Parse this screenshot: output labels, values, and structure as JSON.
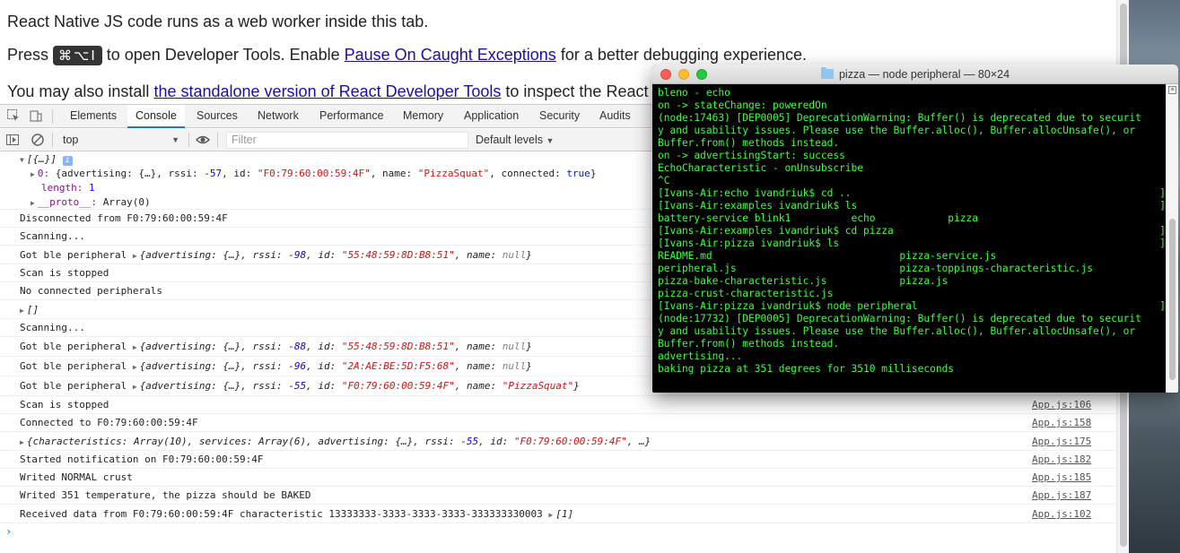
{
  "page": {
    "line1": "React Native JS code runs as a web worker inside this tab.",
    "line2_prefix": "Press",
    "line2_kbd": "⌘⌥I",
    "line2_middle": "to open Developer Tools. Enable",
    "line2_link": "Pause On Caught Exceptions",
    "line2_suffix": "for a better debugging experience.",
    "line3_prefix": "You may also install",
    "line3_link": "the standalone version of React Developer Tools",
    "line3_suffix": "to inspect the React"
  },
  "devtools": {
    "tabs": [
      "Elements",
      "Console",
      "Sources",
      "Network",
      "Performance",
      "Memory",
      "Application",
      "Security",
      "Audits"
    ],
    "active_tab": "Console",
    "context": "top",
    "filter_placeholder": "Filter",
    "levels": "Default levels"
  },
  "console": {
    "array_header": "[{…}]",
    "array_item_index": "0:",
    "array_item_body": "{advertising: {…}, rssi: -57, id: \"F0:79:60:00:59:4F\", name: \"PizzaSquat\", connected: true}",
    "length_key": "length:",
    "length_val": "1",
    "proto_key": "__proto__:",
    "proto_val": "Array(0)",
    "rows": [
      {
        "text": "Disconnected from F0:79:60:00:59:4F",
        "src": ""
      },
      {
        "text": "Scanning...",
        "src": ""
      },
      {
        "text": "Got ble peripheral",
        "obj": "{advertising: {…}, rssi: -98, id: \"55:48:59:8D:B8:51\", name: null}",
        "src": ""
      },
      {
        "text": "Scan is stopped",
        "src": ""
      },
      {
        "text": "No connected peripherals",
        "src": ""
      },
      {
        "text": "",
        "obj": "[]",
        "src": ""
      },
      {
        "text": "Scanning...",
        "src": ""
      },
      {
        "text": "Got ble peripheral",
        "obj": "{advertising: {…}, rssi: -88, id: \"55:48:59:8D:B8:51\", name: null}",
        "src": ""
      },
      {
        "text": "Got ble peripheral",
        "obj": "{advertising: {…}, rssi: -96, id: \"2A:AE:BE:5D:F5:68\", name: null}",
        "src": ""
      },
      {
        "text": "Got ble peripheral",
        "obj": "{advertising: {…}, rssi: -55, id: \"F0:79:60:00:59:4F\", name: \"PizzaSquat\"}",
        "src": ""
      },
      {
        "text": "Scan is stopped",
        "src": "App.js:106"
      },
      {
        "text": "Connected to F0:79:60:00:59:4F",
        "src": "App.js:158"
      },
      {
        "text": "",
        "obj": "{characteristics: Array(10), services: Array(6), advertising: {…}, rssi: -55, id: \"F0:79:60:00:59:4F\", …}",
        "src": "App.js:175"
      },
      {
        "text": "Started notification on F0:79:60:00:59:4F",
        "src": "App.js:182"
      },
      {
        "text": "Writed NORMAL crust",
        "src": "App.js:185"
      },
      {
        "text": "Writed 351 temperature, the pizza should be BAKED",
        "src": "App.js:187"
      },
      {
        "text": "Received data from F0:79:60:00:59:4F characteristic 13333333-3333-3333-3333-333333330003",
        "obj": "[1]",
        "src": "App.js:102"
      }
    ]
  },
  "terminal": {
    "title": "pizza — node peripheral — 80×24",
    "lines": [
      "bleno - echo",
      "on -> stateChange: poweredOn",
      "(node:17463) [DEP0005] DeprecationWarning: Buffer() is deprecated due to securit",
      "y and usability issues. Please use the Buffer.alloc(), Buffer.allocUnsafe(), or",
      "Buffer.from() methods instead.",
      "on -> advertisingStart: success",
      "EchoCharacteristic - onUnsubscribe",
      "^C",
      "[Ivans-Air:echo ivandriuk$ cd ..",
      "[Ivans-Air:examples ivandriuk$ ls",
      "battery-service blink1          echo            pizza",
      "[Ivans-Air:examples ivandriuk$ cd pizza",
      "[Ivans-Air:pizza ivandriuk$ ls",
      "README.md                               pizza-service.js",
      "peripheral.js                           pizza-toppings-characteristic.js",
      "pizza-bake-characteristic.js            pizza.js",
      "pizza-crust-characteristic.js",
      "[Ivans-Air:pizza ivandriuk$ node peripheral",
      "(node:17732) [DEP0005] DeprecationWarning: Buffer() is deprecated due to securit",
      "y and usability issues. Please use the Buffer.alloc(), Buffer.allocUnsafe(), or",
      "Buffer.from() methods instead.",
      "advertising...",
      "baking pizza at 351 degrees for 3510 milliseconds"
    ],
    "bracket_lines": [
      8,
      9,
      11,
      12,
      17
    ],
    "text_color": "#3cff3c"
  }
}
